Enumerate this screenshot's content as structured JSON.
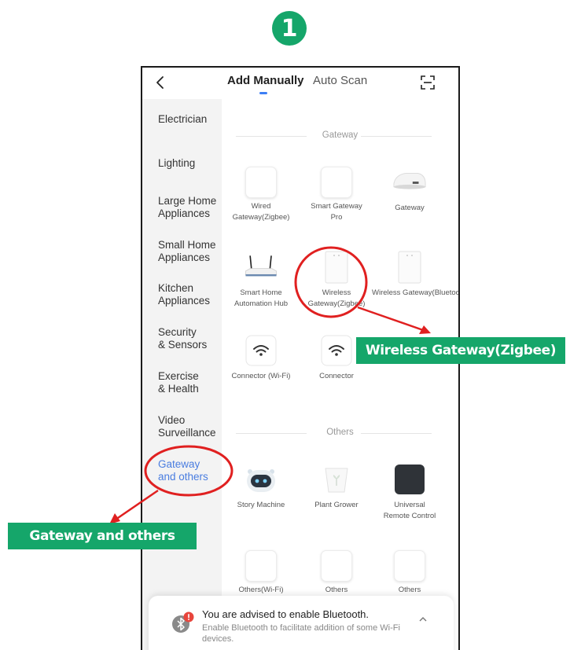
{
  "step_number": "1",
  "header": {
    "tabs": [
      {
        "label": "Add Manually",
        "active": true
      },
      {
        "label": "Auto Scan",
        "active": false
      }
    ],
    "icons": {
      "back": "chevron-left-icon",
      "scan": "scan-icon"
    },
    "accent_color": "#3d7ff5"
  },
  "sidebar": {
    "categories": [
      {
        "label": "Electrician"
      },
      {
        "label": "Lighting"
      },
      {
        "label": "Large Home\nAppliances"
      },
      {
        "label": "Small Home\nAppliances"
      },
      {
        "label": "Kitchen\nAppliances"
      },
      {
        "label": "Security\n& Sensors"
      },
      {
        "label": "Exercise\n& Health"
      },
      {
        "label": "Video\nSurveillance"
      },
      {
        "label": "Gateway\nand others",
        "active": true
      }
    ]
  },
  "sections": [
    {
      "title": "Gateway",
      "devices": [
        {
          "label": "Wired\nGateway(Zigbee)",
          "icon": "white-square-device-icon"
        },
        {
          "label": "Smart Gateway\nPro",
          "icon": "white-square-device-icon"
        },
        {
          "label": "Gateway",
          "icon": "flat-gateway-device-icon"
        },
        {
          "label": "Smart Home\nAutomation Hub",
          "icon": "router-device-icon"
        },
        {
          "label": "Wireless\nGateway(Zigbee)",
          "icon": "wall-box-device-icon"
        },
        {
          "label": "Wireless\nGateway(Bluetoot",
          "icon": "wall-box-device-icon"
        },
        {
          "label": "Connector (Wi-Fi)",
          "icon": "wifi-icon"
        },
        {
          "label": "Connector",
          "icon": "wifi-icon"
        }
      ]
    },
    {
      "title": "Others",
      "devices": [
        {
          "label": "Story Machine",
          "icon": "robot-speaker-icon"
        },
        {
          "label": "Plant Grower",
          "icon": "plant-pot-icon"
        },
        {
          "label": "Universal\nRemote Control",
          "icon": "remote-hub-icon"
        },
        {
          "label": "Others(Wi-Fi)",
          "icon": "white-square-device-icon"
        },
        {
          "label": "Others",
          "icon": "white-square-device-icon"
        },
        {
          "label": "Others",
          "icon": "white-square-device-icon"
        }
      ]
    }
  ],
  "bluetooth_banner": {
    "title": "You are advised to enable Bluetooth.",
    "subtitle": "Enable Bluetooth to facilitate addition of some Wi-Fi devices.",
    "icon": "bluetooth-icon"
  },
  "annotations": {
    "callouts": [
      {
        "label": "Wireless Gateway(Zigbee)"
      },
      {
        "label": "Gateway and others"
      }
    ],
    "highlight_color": "#e02020",
    "callout_color": "#15a66a"
  }
}
